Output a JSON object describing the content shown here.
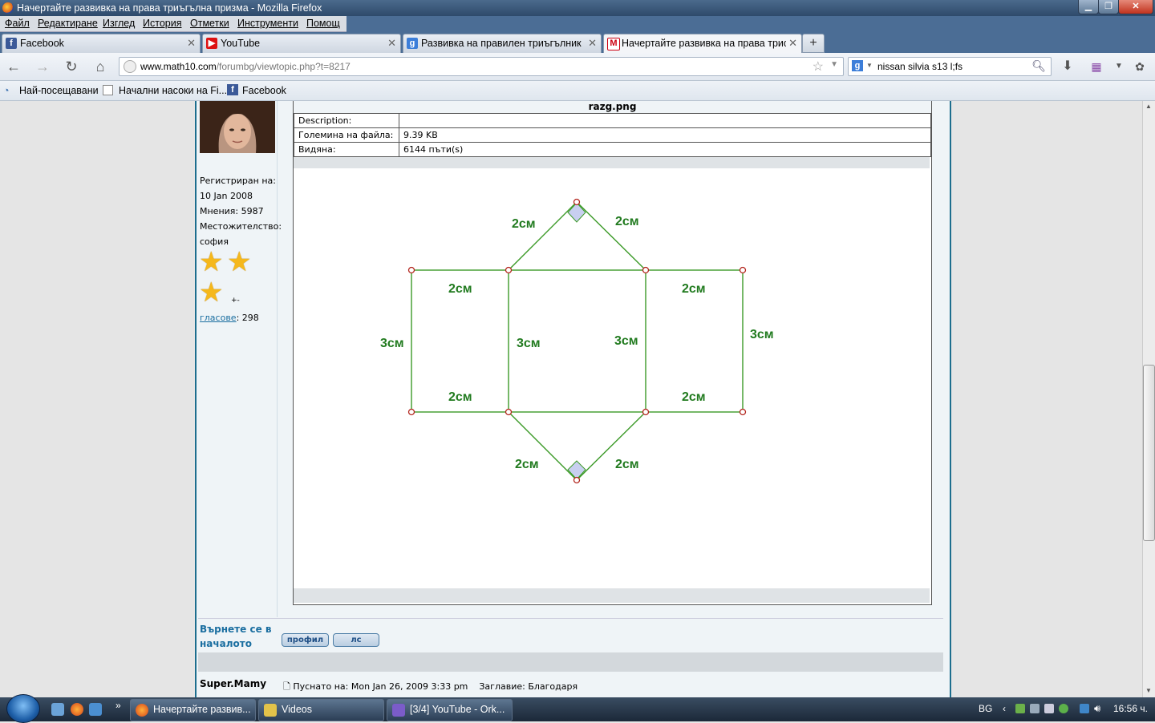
{
  "window": {
    "title": "Начертайте развивка на права триъгълна призма - Mozilla Firefox"
  },
  "menu": [
    "Файл",
    "Редактиране",
    "Изглед",
    "История",
    "Отметки",
    "Инструменти",
    "Помощ"
  ],
  "tabs": [
    {
      "label": "Facebook"
    },
    {
      "label": "YouTube"
    },
    {
      "label": "Развивка на правилен триъгълник ..."
    },
    {
      "label": "Начертайте развивка на права трис..."
    }
  ],
  "nav": {
    "url_host": "www.math10.com",
    "url_path": "/forumbg/viewtopic.php?t=8217",
    "search": "nissan silvia s13 l;fs"
  },
  "bookmarks": [
    "Най-посещавани",
    "Начални насоки на Fi...",
    "Facebook"
  ],
  "profile": {
    "registered_label": "Регистриран на:",
    "registered_date": "10 Jan 2008",
    "posts": "Мнения: 5987",
    "location_label": "Местожителство:",
    "location": "софия",
    "votes_link": "гласове",
    "votes_count": ": 298",
    "plusminus": "+-"
  },
  "attachment": {
    "filename": "razg.png",
    "rows": [
      {
        "label": "Description:",
        "value": ""
      },
      {
        "label": "Големина на файла:",
        "value": "9.39 KB"
      },
      {
        "label": "Видяна:",
        "value": "6144 пъти(s)"
      }
    ]
  },
  "diagram": {
    "labels": [
      "2см",
      "2см",
      "2см",
      "2см",
      "2см",
      "2см",
      "2см",
      "2см",
      "3см",
      "3см",
      "3см",
      "3см"
    ]
  },
  "footer": {
    "back_to_top_1": "Върнете се в",
    "back_to_top_2": "началото",
    "profile_btn": "профил",
    "pm_btn": "лс"
  },
  "next_post": {
    "author": "Super.Mamy",
    "posted": "Пуснато на: Mon Jan 26, 2009 3:33 pm    Заглавие: Благодаря"
  },
  "taskbar": {
    "tasks": [
      "Начертайте развив...",
      "Videos",
      "[3/4] YouTube - Ork..."
    ],
    "lang": "BG",
    "clock": "16:56 ч."
  }
}
